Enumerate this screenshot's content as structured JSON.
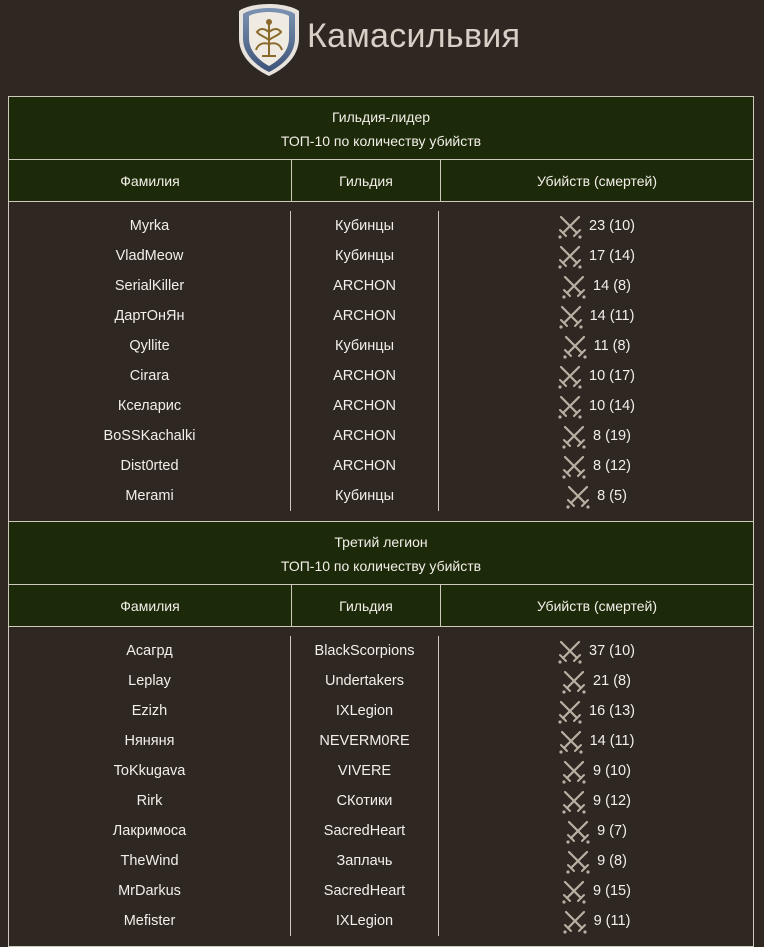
{
  "header": {
    "title": "Камасильвия",
    "logo_icon": "kamasylvia-shield-icon"
  },
  "colors": {
    "background": "#2f2722",
    "header_bg": "#1d2a09",
    "border": "#cfc8bd",
    "text": "#f2efe9",
    "sword_icon": "#b8b1a3"
  },
  "sections": [
    {
      "title": "Гильдия-лидер",
      "subtitle": "ТОП-10 по количеству убийств",
      "columns": [
        "Фамилия",
        "Гильдия",
        "Убийств (смертей)"
      ],
      "rows": [
        {
          "name": "Myrka",
          "guild": "Кубинцы",
          "kills": "23 (10)"
        },
        {
          "name": "VladMeow",
          "guild": "Кубинцы",
          "kills": "17 (14)"
        },
        {
          "name": "SerialKiller",
          "guild": "ARCHON",
          "kills": "14 (8)"
        },
        {
          "name": "ДартОнЯн",
          "guild": "ARCHON",
          "kills": "14 (11)"
        },
        {
          "name": "Qyllite",
          "guild": "Кубинцы",
          "kills": "11 (8)"
        },
        {
          "name": "Cirara",
          "guild": "ARCHON",
          "kills": "10 (17)"
        },
        {
          "name": "Кселарис",
          "guild": "ARCHON",
          "kills": "10 (14)"
        },
        {
          "name": "BoSSKachalki",
          "guild": "ARCHON",
          "kills": "8 (19)"
        },
        {
          "name": "Dist0rted",
          "guild": "ARCHON",
          "kills": "8 (12)"
        },
        {
          "name": "Merami",
          "guild": "Кубинцы",
          "kills": "8 (5)"
        }
      ]
    },
    {
      "title": "Третий легион",
      "subtitle": "ТОП-10 по количеству убийств",
      "columns": [
        "Фамилия",
        "Гильдия",
        "Убийств (смертей)"
      ],
      "rows": [
        {
          "name": "Асагрд",
          "guild": "BlackScorpions",
          "kills": "37 (10)"
        },
        {
          "name": "Leplay",
          "guild": "Undertakers",
          "kills": "21 (8)"
        },
        {
          "name": "Ezizh",
          "guild": "IXLegion",
          "kills": "16 (13)"
        },
        {
          "name": "Няняня",
          "guild": "NEVERM0RE",
          "kills": "14 (11)"
        },
        {
          "name": "ToKkugava",
          "guild": "VIVERE",
          "kills": "9 (10)"
        },
        {
          "name": "Rirk",
          "guild": "СКотики",
          "kills": "9 (12)"
        },
        {
          "name": "Лакримоса",
          "guild": "SacredHeart",
          "kills": "9 (7)"
        },
        {
          "name": "TheWind",
          "guild": "Заплачь",
          "kills": "9 (8)"
        },
        {
          "name": "MrDarkus",
          "guild": "SacredHeart",
          "kills": "9 (15)"
        },
        {
          "name": "Mefister",
          "guild": "IXLegion",
          "kills": "9 (11)"
        }
      ]
    }
  ]
}
